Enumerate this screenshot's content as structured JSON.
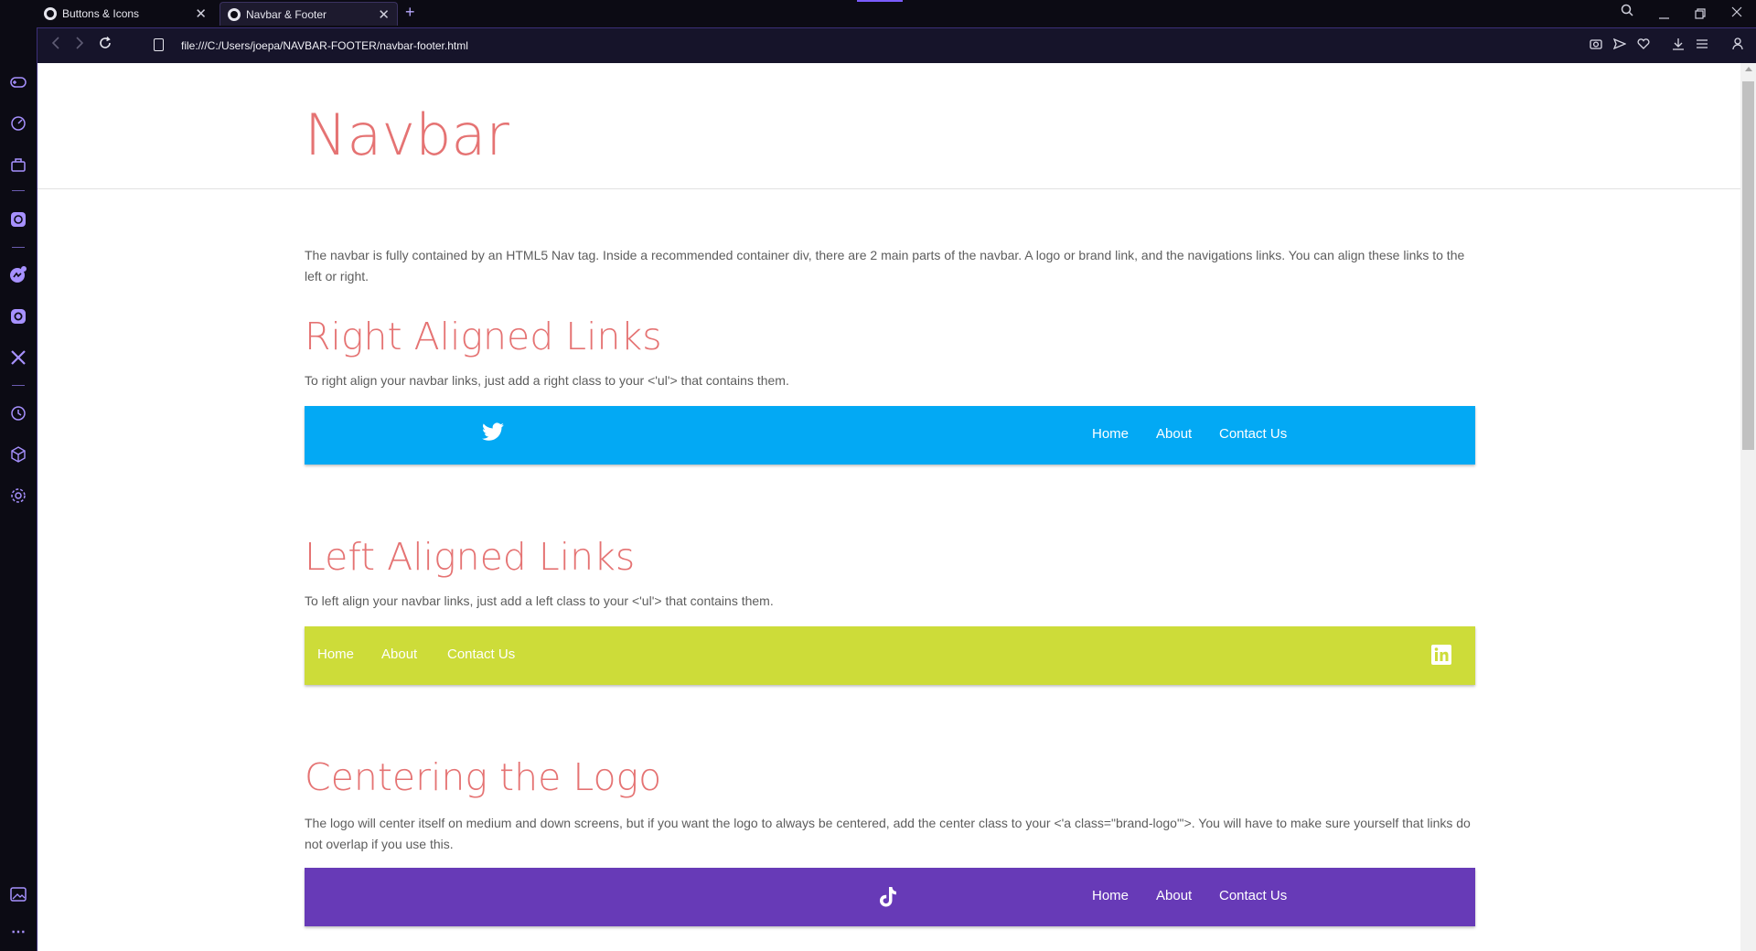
{
  "browser": {
    "tabs": [
      {
        "label": "Buttons & Icons"
      },
      {
        "label": "Navbar & Footer"
      }
    ],
    "url": "file:///C:/Users/joepa/NAVBAR-FOOTER/navbar-footer.html"
  },
  "page": {
    "title": "Navbar",
    "intro": "The navbar is fully contained by an HTML5 Nav tag. Inside a recommended container div, there are 2 main parts of the navbar. A logo or brand link, and the navigations links. You can align these links to the left or right.",
    "sections": [
      {
        "heading": "Right Aligned Links",
        "text": "To right align your navbar links, just add a right class to your <'ul'> that contains them.",
        "navbar": {
          "color": "#03a9f4",
          "logo_icon": "twitter-icon",
          "links": [
            "Home",
            "About",
            "Contact Us"
          ]
        }
      },
      {
        "heading": "Left Aligned Links",
        "text": "To left align your navbar links, just add a left class to your <'ul'> that contains them.",
        "navbar": {
          "color": "#cddc39",
          "logo_icon": "linkedin-icon",
          "links": [
            "Home",
            "About",
            "Contact Us"
          ]
        }
      },
      {
        "heading": "Centering the Logo",
        "text": "The logo will center itself on medium and down screens, but if you want the logo to always be centered, add the center class to your <'a class=\"brand-logo\"'>. You will have to make sure yourself that links do not overlap if you use this.",
        "navbar": {
          "color": "#673ab7",
          "logo_icon": "tiktok-icon",
          "links": [
            "Home",
            "About",
            "Contact Us"
          ]
        }
      }
    ]
  },
  "colors": {
    "heading": "#e57373",
    "text": "#5d5d5d",
    "browser_accent": "#a791ff"
  }
}
